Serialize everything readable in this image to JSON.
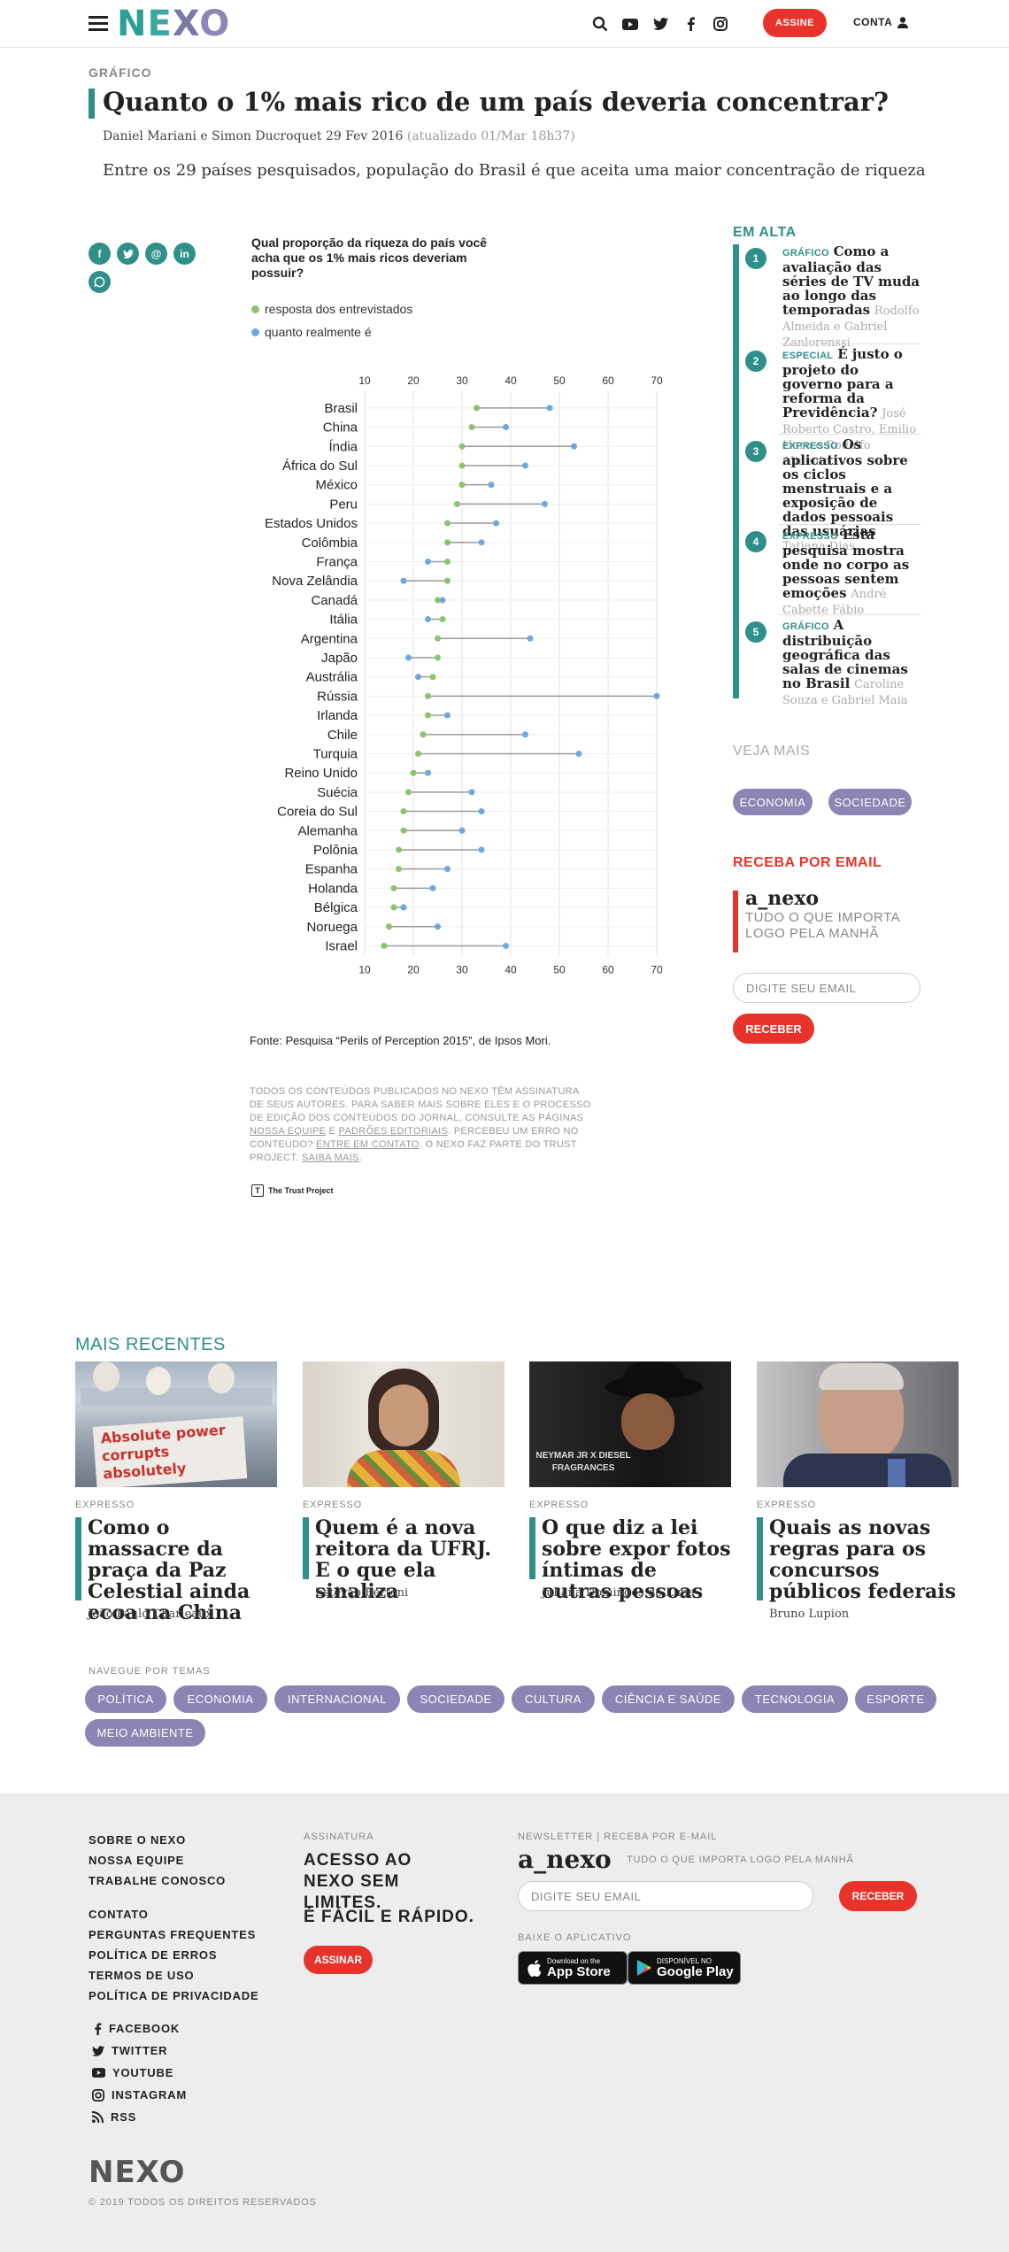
{
  "header": {
    "logo": "NEXO",
    "assine_label": "ASSINE",
    "conta_label": "CONTA"
  },
  "article": {
    "kicker": "GRÁFICO",
    "title": "Quanto o 1% mais rico de um país deveria concentrar?",
    "authors_date": "Daniel Mariani e Simon Ducroquet 29 Fev 2016",
    "updated": "(atualizado 01/Mar 18h37)",
    "lead": "Entre os 29 países pesquisados, população do Brasil é que aceita uma maior concentração de riqueza"
  },
  "share": {
    "icons": [
      "facebook-icon",
      "twitter-icon",
      "email-icon",
      "linkedin-icon",
      "whatsapp-icon"
    ]
  },
  "chart_data": {
    "type": "scatter",
    "subtype": "dumbbell",
    "question": "Qual proporção da riqueza do país você acha que os 1% mais ricos deveriam possuir?",
    "xlim": [
      10,
      70
    ],
    "xticks": [
      10,
      20,
      30,
      40,
      50,
      60,
      70
    ],
    "grid": true,
    "legend_position": "top-left",
    "colors": {
      "resposta": "#8dc26f",
      "realidade": "#6fa8dc",
      "line": "#999999"
    },
    "categories": [
      "Brasil",
      "China",
      "Índia",
      "África do Sul",
      "México",
      "Peru",
      "Estados Unidos",
      "Colômbia",
      "França",
      "Nova Zelândia",
      "Canadá",
      "Itália",
      "Argentina",
      "Japão",
      "Austrália",
      "Rússia",
      "Irlanda",
      "Chile",
      "Turquia",
      "Reino Unido",
      "Suécia",
      "Coreia do Sul",
      "Alemanha",
      "Polônia",
      "Espanha",
      "Holanda",
      "Bélgica",
      "Noruega",
      "Israel"
    ],
    "series": [
      {
        "name": "resposta dos entrevistados",
        "values": [
          33,
          32,
          30,
          30,
          30,
          29,
          27,
          27,
          27,
          27,
          25,
          26,
          25,
          25,
          24,
          23,
          23,
          22,
          21,
          20,
          19,
          18,
          18,
          17,
          17,
          16,
          16,
          15,
          14
        ]
      },
      {
        "name": "quanto realmente é",
        "values": [
          48,
          39,
          53,
          43,
          36,
          47,
          37,
          34,
          23,
          18,
          26,
          23,
          44,
          19,
          21,
          70,
          27,
          43,
          54,
          23,
          32,
          34,
          30,
          34,
          27,
          24,
          18,
          25,
          39
        ]
      }
    ],
    "source": "Fonte: Pesquisa “Perils of Perception 2015”, de Ipsos Mori."
  },
  "legal": {
    "text1": "TODOS OS CONTEÚDOS PUBLICADOS NO NEXO TÊM ASSINATURA DE SEUS AUTORES. PARA SABER MAIS SOBRE ELES E O PROCESSO DE EDIÇÃO DOS CONTEÚDOS DO JORNAL, CONSULTE AS PÁGINAS ",
    "link1": "NOSSA EQUIPE",
    "and": " E ",
    "link2": "PADRÕES EDITORIAIS",
    "text2": ". PERCEBEU UM ERRO NO CONTEÚDO? ",
    "link3": "ENTRE EM CONTATO",
    "text3": ". O NEXO FAZ PARTE DO TRUST PROJECT. ",
    "link4": "SAIBA MAIS",
    "text4": ".",
    "trust": "The Trust Project"
  },
  "sidebar": {
    "em_alta_title": "EM ALTA",
    "items": [
      {
        "num": "1",
        "tag": "GRÁFICO",
        "headline": "Como a avaliação das séries de TV muda ao longo das temporadas",
        "authors": "Rodolfo Almeida e Gabriel Zanlorenssi"
      },
      {
        "num": "2",
        "tag": "ESPECIAL",
        "headline": "É justo o projeto do governo para a reforma da Previdência?",
        "authors": "José Roberto Castro, Emilio Haro e Rodolfo Almeida"
      },
      {
        "num": "3",
        "tag": "EXPRESSO",
        "headline": "Os aplicativos sobre os ciclos menstruais e a exposição de dados pessoais das usuárias",
        "authors": "Tatiana Dias"
      },
      {
        "num": "4",
        "tag": "EXPRESSO",
        "headline": "Esta pesquisa mostra onde no corpo as pessoas sentem emoções",
        "authors": "André Cabette Fábio"
      },
      {
        "num": "5",
        "tag": "GRÁFICO",
        "headline": "A distribuição geográfica das salas de cinemas no Brasil",
        "authors": "Caroline Souza e Gabriel Maia"
      }
    ],
    "veja_mais": "VEJA MAIS",
    "veja_tags": [
      "ECONOMIA",
      "SOCIEDADE"
    ],
    "receba_title": "RECEBA POR EMAIL",
    "anexo": "a_nexo",
    "anexo_sub": "TUDO O QUE IMPORTA LOGO PELA MANHÃ",
    "email_placeholder": "DIGITE SEU EMAIL",
    "receber": "RECEBER"
  },
  "recentes": {
    "title": "MAIS RECENTES",
    "cards": [
      {
        "tag": "EXPRESSO",
        "title": "Como o massacre da praça da Paz Celestial ainda ecoa na China",
        "author": "João Paulo Charleaux",
        "img_text": "Absolute power corrupts absolutely"
      },
      {
        "tag": "EXPRESSO",
        "title": "Quem é a nova reitora da UFRJ. E o que ela sinaliza",
        "author": "Estêvão Bertoni"
      },
      {
        "tag": "EXPRESSO",
        "title": "O que diz a lei sobre expor fotos íntimas de outras pessoas",
        "author": "Juliana Domingos de Lima",
        "img_text": "NEYMAR JR X DIESEL FRAGRANCES"
      },
      {
        "tag": "EXPRESSO",
        "title": "Quais as novas regras para os concursos públicos federais",
        "author": "Bruno Lupion"
      }
    ]
  },
  "temas": {
    "title": "NAVEGUE POR TEMAS",
    "items": [
      "POLÍTICA",
      "ECONOMIA",
      "INTERNACIONAL",
      "SOCIEDADE",
      "CULTURA",
      "CIÊNCIA E SAÚDE",
      "TECNOLOGIA",
      "ESPORTE",
      "MEIO AMBIENTE"
    ]
  },
  "footer": {
    "links1": [
      "SOBRE O NEXO",
      "NOSSA EQUIPE",
      "TRABALHE CONOSCO"
    ],
    "links2": [
      "CONTATO",
      "PERGUNTAS FREQUENTES",
      "POLÍTICA DE ERROS",
      "TERMOS DE USO",
      "POLÍTICA DE PRIVACIDADE"
    ],
    "social": [
      "FACEBOOK",
      "TWITTER",
      "YOUTUBE",
      "INSTAGRAM",
      "RSS"
    ],
    "assinatura_label": "ASSINATURA",
    "assinatura_big1": "ACESSO AO NEXO SEM LIMITES.",
    "assinatura_big2": "É FÁCIL E RÁPIDO.",
    "assinar": "ASSINAR",
    "newsletter_label": "NEWSLETTER | RECEBA POR E-MAIL",
    "anexo": "a_nexo",
    "anexo_sub": "TUDO O QUE IMPORTA LOGO PELA MANHÃ",
    "email_placeholder": "DIGITE SEU EMAIL",
    "receber": "RECEBER",
    "app_label": "BAIXE O APLICATIVO",
    "appstore_small": "Download on the",
    "appstore_big": "App Store",
    "gplay_small": "DISPONÍVEL NO",
    "gplay_big": "Google Play",
    "logo": "NEXO",
    "copyright": "© 2019 TODOS OS DIREITOS RESERVADOS"
  }
}
